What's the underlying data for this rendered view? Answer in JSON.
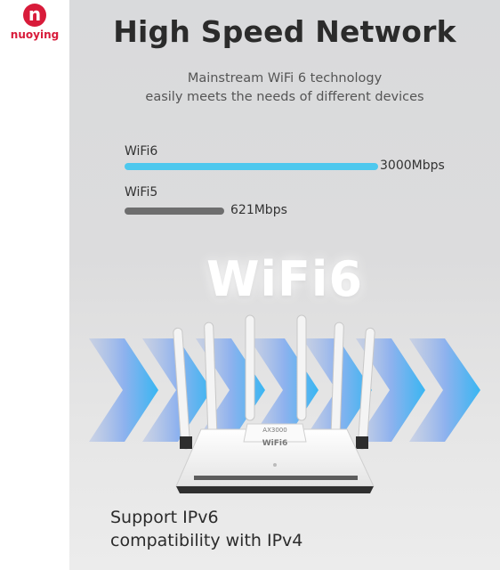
{
  "brand": {
    "name": "nuoying",
    "mark": "n",
    "color": "#d81b3a"
  },
  "header": {
    "title": "High Speed Network",
    "subtitle_line1": "Mainstream WiFi 6 technology",
    "subtitle_line2": "easily meets the needs of different devices"
  },
  "speed_bars": [
    {
      "label": "WiFi6",
      "value_text": "3000Mbps",
      "value": 3000,
      "unit": "Mbps",
      "color": "#4dc8ee"
    },
    {
      "label": "WiFi5",
      "value_text": "621Mbps",
      "value": 621,
      "unit": "Mbps",
      "color": "#6e6e6e"
    }
  ],
  "wifi6_logo": "WiFi6",
  "router": {
    "model_label": "AX3000",
    "badge_text": "WiFi6",
    "color": "#f5f5f5"
  },
  "arrows": {
    "color_light": "#9cb8e8",
    "color_bright": "#3db4f0"
  },
  "features": {
    "line1": "Support IPv6",
    "line2": "compatibility with IPv4"
  }
}
